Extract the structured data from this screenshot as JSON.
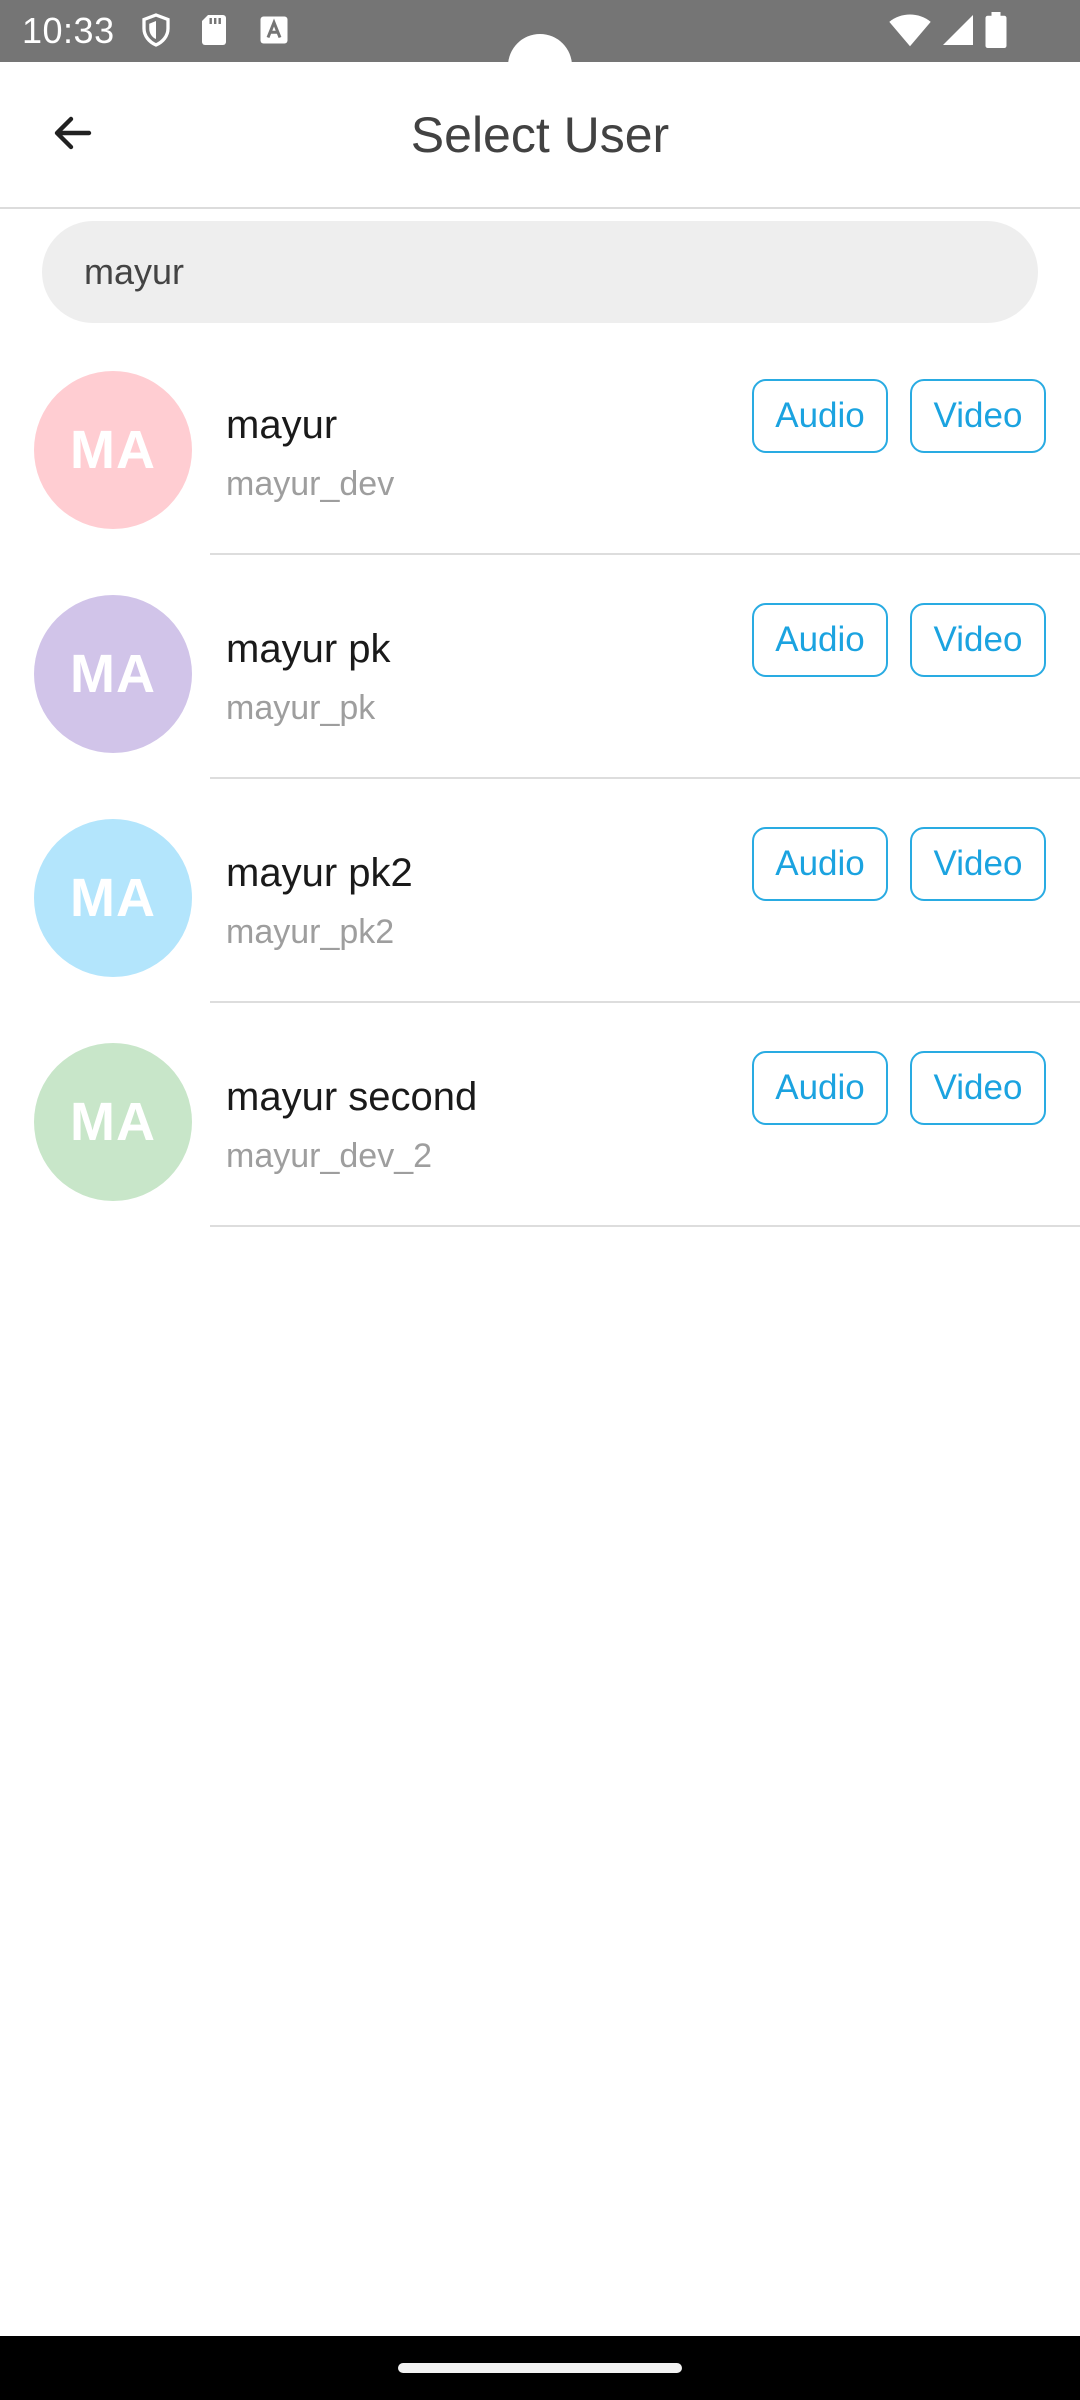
{
  "status_bar": {
    "time": "10:33",
    "left_icons": [
      "shield-icon",
      "sd-card-icon",
      "font-a-icon"
    ],
    "right_icons": [
      "wifi-icon",
      "signal-icon",
      "battery-icon"
    ]
  },
  "header": {
    "back_icon": "arrow-left-icon",
    "title": "Select User"
  },
  "search": {
    "value": "mayur",
    "placeholder": ""
  },
  "users": [
    {
      "initials": "MA",
      "name": "mayur",
      "handle": "mayur_dev",
      "avatar_color": "#ffcdd2",
      "audio_label": "Audio",
      "video_label": "Video"
    },
    {
      "initials": "MA",
      "name": "mayur pk",
      "handle": "mayur_pk",
      "avatar_color": "#d1c4e9",
      "audio_label": "Audio",
      "video_label": "Video"
    },
    {
      "initials": "MA",
      "name": "mayur pk2",
      "handle": "mayur_pk2",
      "avatar_color": "#b3e5fc",
      "audio_label": "Audio",
      "video_label": "Video"
    },
    {
      "initials": "MA",
      "name": "mayur second",
      "handle": "mayur_dev_2",
      "avatar_color": "#c8e6c9",
      "audio_label": "Audio",
      "video_label": "Video"
    }
  ],
  "colors": {
    "status_bar": "#757575",
    "accent": "#1ba3e0",
    "divider": "#dddddd",
    "search_bg": "#eeeeee"
  }
}
